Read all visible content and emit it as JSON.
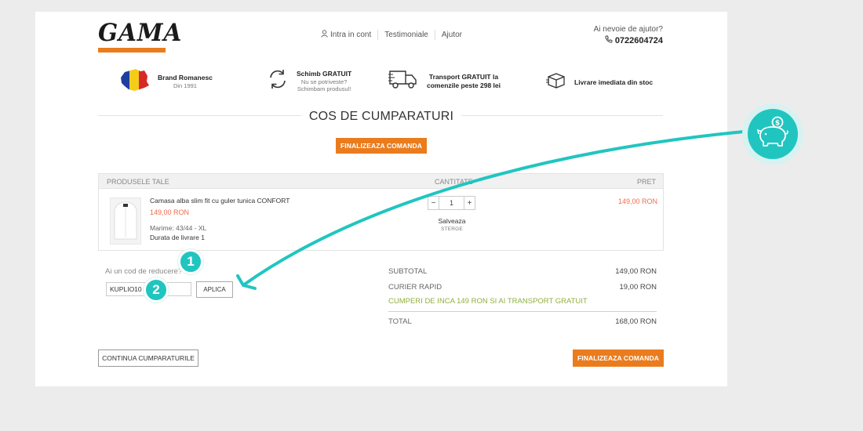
{
  "header": {
    "logo_text": "GAMA",
    "nav": [
      "Intra in cont",
      "Testimoniale",
      "Ajutor"
    ],
    "help_label": "Ai nevoie de ajutor?",
    "phone": "0722604724"
  },
  "benefits": [
    {
      "title": "Brand Romanesc",
      "sub": [
        "Din 1991"
      ],
      "icon": "romania-map-icon"
    },
    {
      "title": "Schimb GRATUIT",
      "sub": [
        "Nu se potriveste?",
        "Schimbam produsul!"
      ],
      "icon": "refresh-icon"
    },
    {
      "title": "Transport GRATUIT la comenzile peste 298 lei",
      "sub": [],
      "icon": "truck-icon"
    },
    {
      "title": "Livrare imediata din stoc",
      "sub": [],
      "icon": "box-icon"
    }
  ],
  "page_title": "COS DE CUMPARATURI",
  "checkout_label": "FINALIZEAZA COMANDA",
  "cart": {
    "headers": [
      "PRODUSELE TALE",
      "CANTITATE",
      "PRET"
    ],
    "items": [
      {
        "name": "Camasa alba slim fit cu guler tunica CONFORT",
        "price": "149,00 RON",
        "size": "Marime: 43/44 - XL",
        "delivery": "Durata de livrare 1",
        "quantity": "1",
        "save_label": "Salveaza",
        "delete_label": "STERGE",
        "line_total": "149,00 RON"
      }
    ]
  },
  "coupon": {
    "label": "Ai un cod de reducere?",
    "value": "KUPLIO10",
    "apply_label": "APLICA"
  },
  "totals": {
    "subtotal_label": "SUBTOTAL",
    "subtotal": "149,00 RON",
    "shipping_label": "CURIER RAPID",
    "shipping": "19,00 RON",
    "promo": "CUMPERI DE INCA 149 RON SI AI TRANSPORT GRATUIT",
    "total_label": "TOTAL",
    "total": "168,00 RON"
  },
  "continue_label": "CONTINUA CUMPARATURILE",
  "annotations": {
    "step1": "1",
    "step2": "2",
    "icon": "piggy-bank-icon",
    "accent": "#21c5c0"
  },
  "colors": {
    "orange": "#ea7c1e",
    "price_red": "#ef6b4d",
    "promo_green": "#8fb03d"
  }
}
